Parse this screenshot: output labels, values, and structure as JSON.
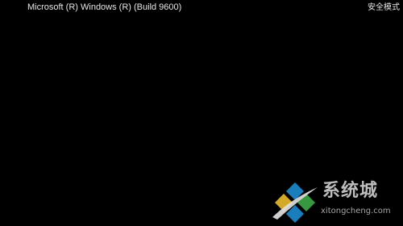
{
  "screen": {
    "background": "#000000",
    "text_color": "#e6e6e6"
  },
  "top_bar": {
    "build_text": "Microsoft (R) Windows (R) (Build 9600)",
    "mode_label": "安全模式"
  },
  "watermark": {
    "title": "系统城",
    "url": "xitongcheng.com",
    "logo_icon": "diamond-logo-icon",
    "logo_colors": {
      "top": "#1e90d8",
      "left": "#f2c12e",
      "right": "#3fae49",
      "bottom": "#1e90d8"
    }
  }
}
